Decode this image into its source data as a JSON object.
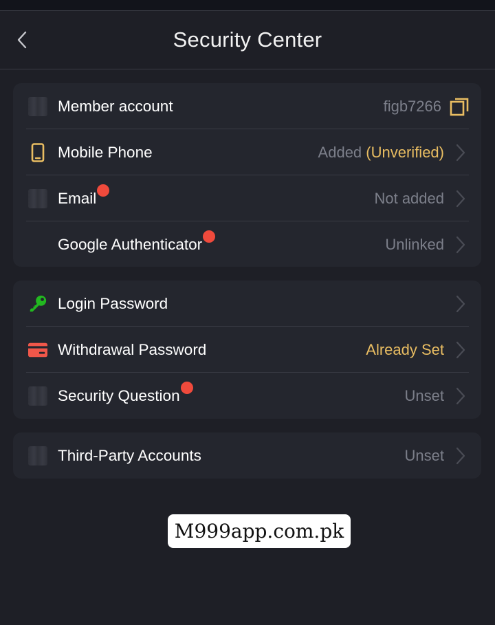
{
  "header": {
    "title": "Security Center"
  },
  "sections": [
    {
      "rows": [
        {
          "label": "Member account",
          "value": "figb7266",
          "has_dot": false,
          "icon": "placeholder-icon",
          "action": "copy"
        },
        {
          "label": "Mobile Phone",
          "value": "Added",
          "value_extra": "(Unverified)",
          "has_dot": false,
          "icon": "mobile-phone-icon",
          "action": "chevron"
        },
        {
          "label": "Email",
          "value": "Not added",
          "has_dot": true,
          "icon": "placeholder-icon",
          "action": "chevron"
        },
        {
          "label": "Google Authenticator",
          "value": "Unlinked",
          "has_dot": true,
          "icon": "none",
          "action": "chevron"
        }
      ]
    },
    {
      "rows": [
        {
          "label": "Login Password",
          "value": "",
          "has_dot": false,
          "icon": "key-icon",
          "action": "chevron"
        },
        {
          "label": "Withdrawal Password",
          "value": "Already Set",
          "has_dot": false,
          "icon": "card-icon",
          "action": "chevron"
        },
        {
          "label": "Security Question",
          "value": "Unset",
          "has_dot": true,
          "icon": "placeholder-icon",
          "action": "chevron"
        }
      ]
    },
    {
      "rows": [
        {
          "label": "Third-Party Accounts",
          "value": "Unset",
          "has_dot": false,
          "icon": "placeholder-icon",
          "action": "chevron"
        }
      ]
    }
  ],
  "watermark": "M999app.com.pk",
  "colors": {
    "background": "#1e1f26",
    "card": "#24262e",
    "accent_gold": "#e9bd62",
    "key_green": "#22b820",
    "card_red": "#f0574a",
    "dot_red": "#f04a3c",
    "muted_text": "#7c7f8a"
  }
}
